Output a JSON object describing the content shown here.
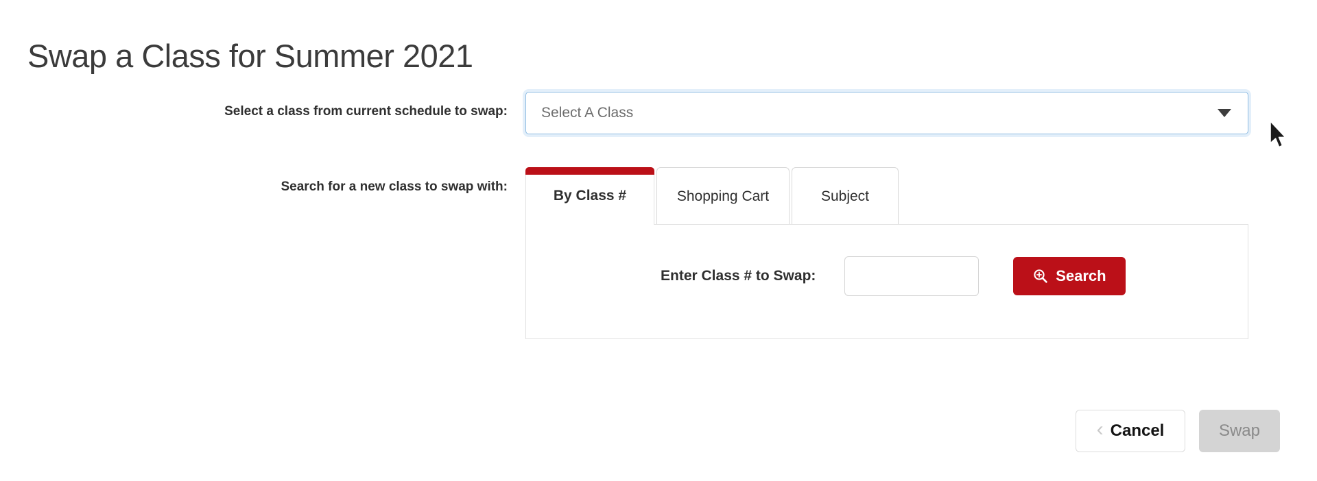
{
  "page": {
    "title": "Swap a Class for Summer 2021"
  },
  "select_row": {
    "label": "Select a class from current schedule to swap:",
    "dropdown": {
      "value": "Select A Class",
      "placeholder": "Select A Class",
      "caret_icon": "chevron-down-icon"
    }
  },
  "search_row": {
    "label": "Search for a new class to swap with:",
    "tabs": [
      {
        "label": "By Class #",
        "active": true
      },
      {
        "label": "Shopping Cart",
        "active": false
      },
      {
        "label": "Subject",
        "active": false
      }
    ],
    "panel": {
      "input_label": "Enter Class # to Swap:",
      "input_value": "",
      "input_placeholder": "",
      "search_button": {
        "label": "Search",
        "icon": "search-plus-icon"
      }
    }
  },
  "footer": {
    "cancel_label": "Cancel",
    "cancel_icon": "chevron-left-icon",
    "swap_label": "Swap",
    "swap_disabled": true
  },
  "colors": {
    "brand_red": "#bb1018",
    "title_gray": "#3b3b3b",
    "focus_blue": "#8fbce2",
    "disabled_gray": "#d4d4d4"
  }
}
